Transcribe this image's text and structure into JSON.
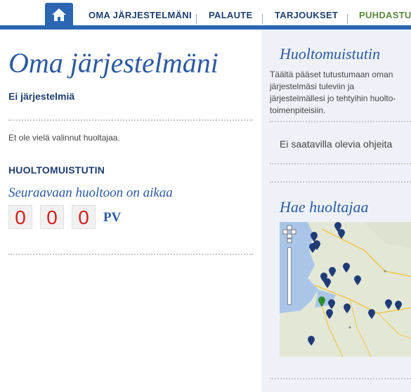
{
  "nav": {
    "items": [
      "OMA JÄRJESTELMÄNI",
      "PALAUTE",
      "TARJOUKSET",
      "PUHDASTUL"
    ],
    "home_icon": "home-icon"
  },
  "colors": {
    "brand": "#2b66b3",
    "heading": "#2c5aa0",
    "counter": "#d42020",
    "nav_last": "#5b8a3a"
  },
  "left": {
    "title": "Oma järjestelmäni",
    "no_systems": "Ei järjestelmiä",
    "no_provider": "Et ole vielä valinnut huoltajaa.",
    "reminder_heading": "HUOLTOMUISTUTIN",
    "next_service": "Seuraavaan huoltoon on aikaa",
    "counter": [
      "0",
      "0",
      "0"
    ],
    "unit": "PV"
  },
  "right": {
    "reminder_title": "Huoltomuistutin",
    "reminder_desc": "Täältä pääset tutustumaan oman\njärjestelmäsi tuleviin ja\njärjestelmällesi jo tehtyihin huolto-\ntoimenpiteisiin.",
    "no_guides": "Ei saatavilla olevia ohjeita",
    "find_title": "Hae huoltajaa"
  }
}
